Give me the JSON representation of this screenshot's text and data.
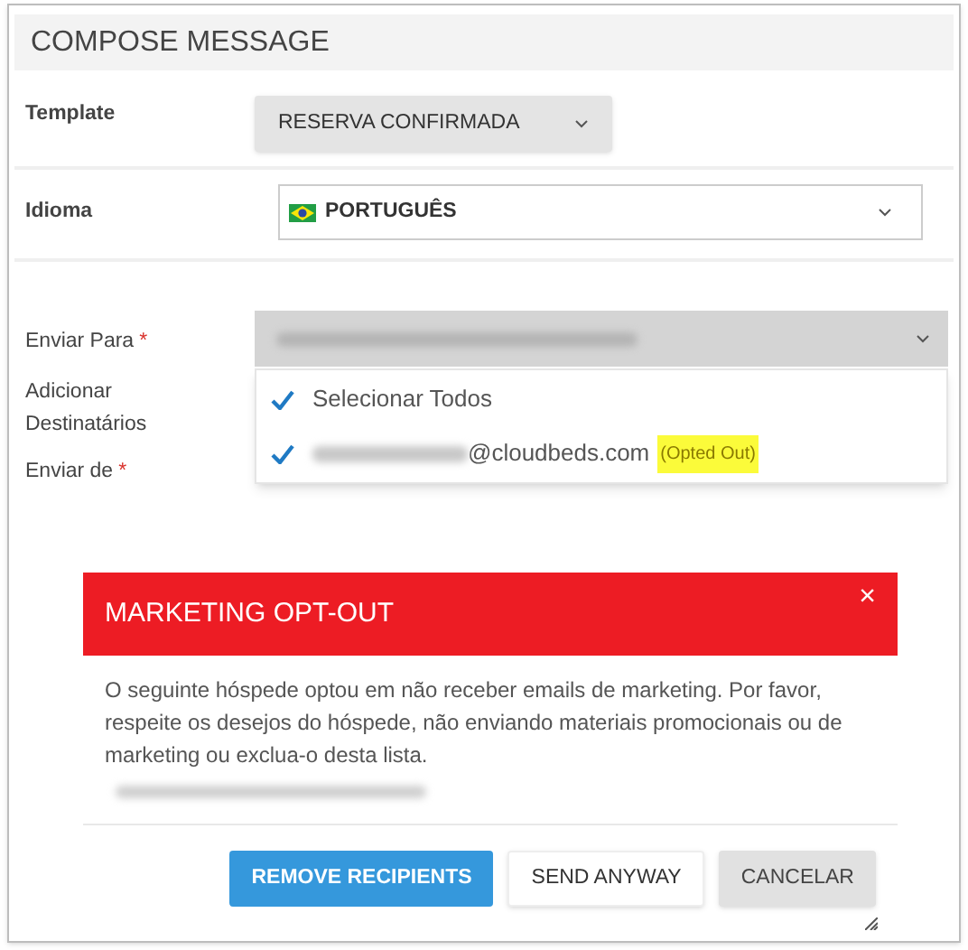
{
  "header": {
    "title": "COMPOSE MESSAGE"
  },
  "template": {
    "label": "Template",
    "value": "RESERVA CONFIRMADA"
  },
  "language": {
    "label": "Idioma",
    "value": "PORTUGUÊS"
  },
  "send_to": {
    "label": "Enviar Para",
    "required_mark": "*"
  },
  "add_recipients": {
    "label": "Adicionar Destinatários"
  },
  "send_from": {
    "label": "Enviar de",
    "required_mark": "*"
  },
  "recipient_menu": [
    {
      "kind": "option",
      "label": "Selecionar Todos",
      "selected": true
    },
    {
      "kind": "recipient",
      "label": "@cloudbeds.com",
      "tag": "(Opted Out)",
      "selected": true
    }
  ],
  "modal": {
    "title": "MARKETING OPT-OUT",
    "close": "×",
    "message": "O seguinte hóspede optou em não receber emails de marketing. Por favor, respeite os desejos do hóspede, não enviando materiais promocionais ou de marketing ou exclua-o desta lista.",
    "buttons": [
      {
        "label": "REMOVE RECIPIENTS",
        "kind": "primary"
      },
      {
        "label": "SEND ANYWAY",
        "kind": "default"
      },
      {
        "label": "CANCELAR",
        "kind": "secondary"
      }
    ]
  }
}
